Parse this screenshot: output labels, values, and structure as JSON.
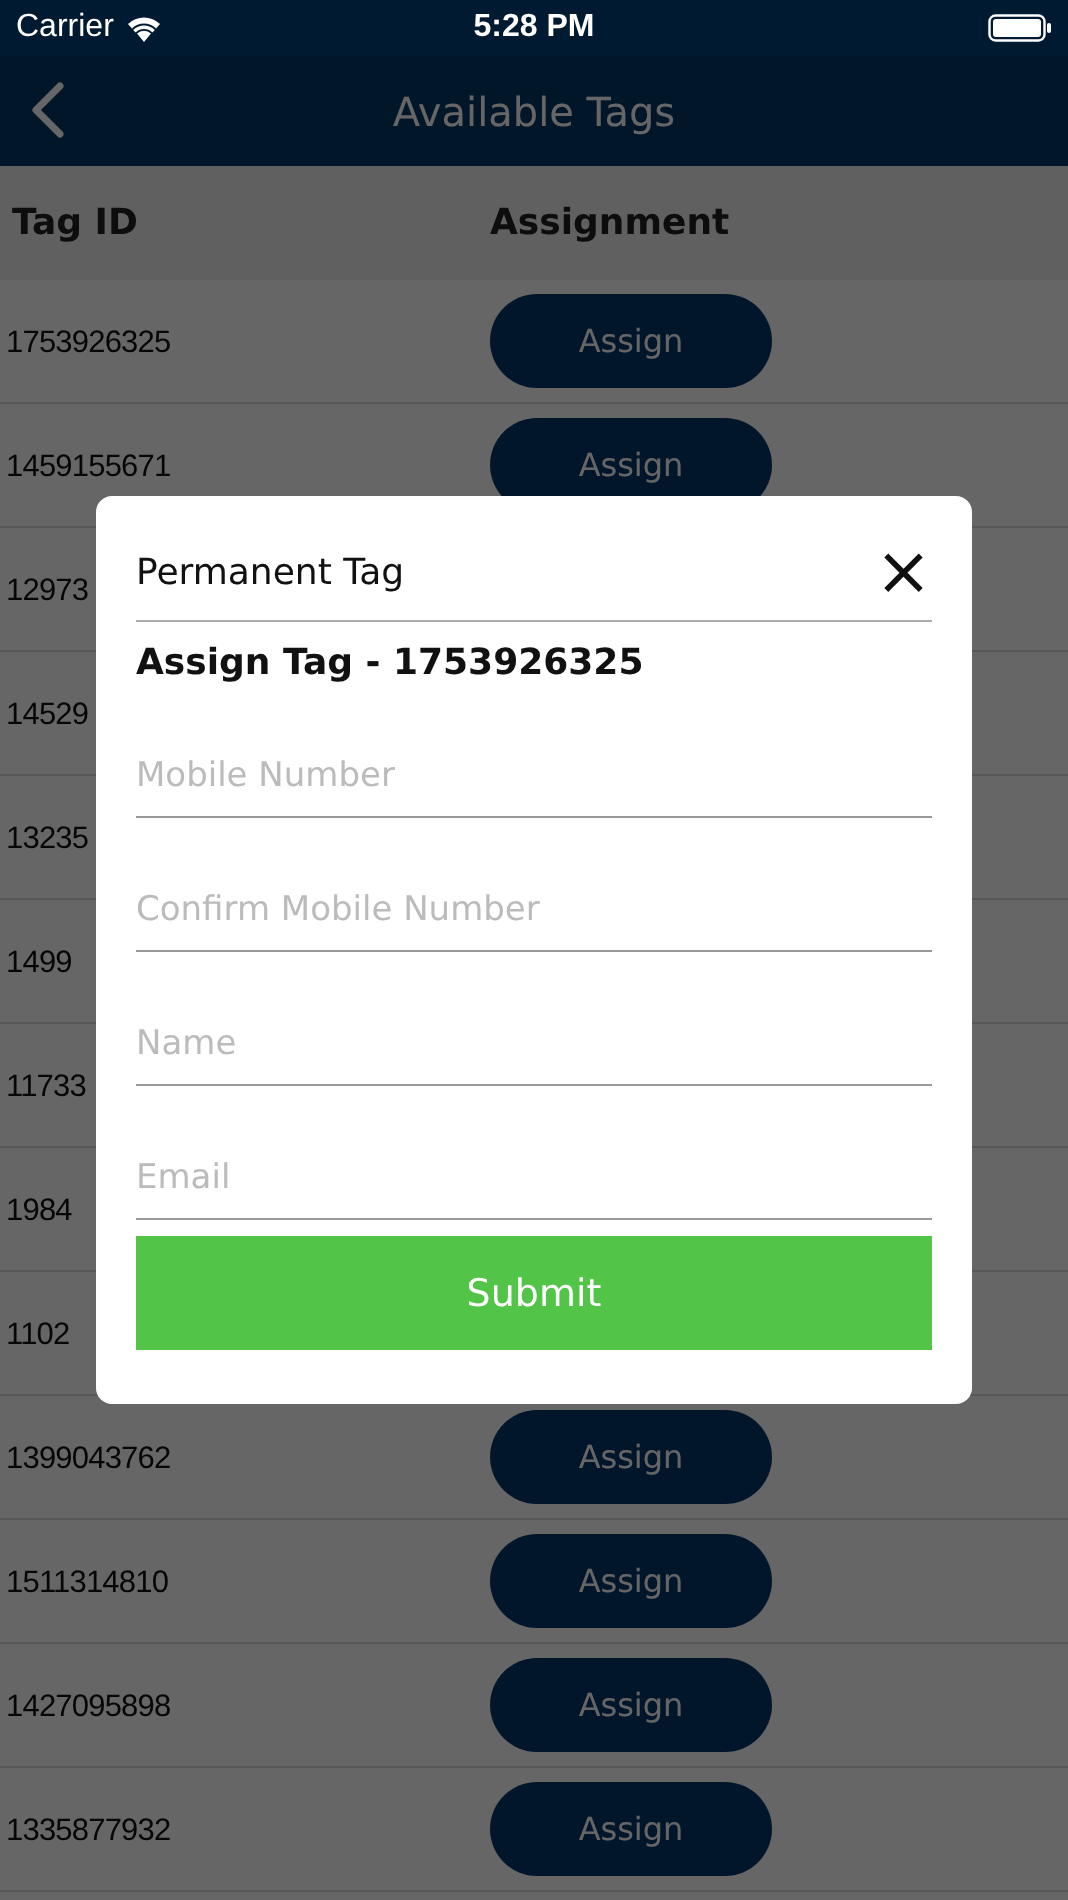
{
  "status_bar": {
    "carrier": "Carrier",
    "time": "5:28 PM"
  },
  "nav": {
    "title": "Available Tags"
  },
  "table": {
    "columns": [
      "Tag ID",
      "Assignment"
    ],
    "rows": [
      {
        "tag_id": "1753926325",
        "action": "Assign"
      },
      {
        "tag_id": "1459155671",
        "action": "Assign"
      },
      {
        "tag_id": "12973"
      },
      {
        "tag_id": "14529"
      },
      {
        "tag_id": "13235"
      },
      {
        "tag_id": "1499"
      },
      {
        "tag_id": "11733"
      },
      {
        "tag_id": "1984"
      },
      {
        "tag_id": "1102"
      },
      {
        "tag_id": "1399043762",
        "action": "Assign"
      },
      {
        "tag_id": "1511314810",
        "action": "Assign"
      },
      {
        "tag_id": "1427095898",
        "action": "Assign"
      },
      {
        "tag_id": "1335877932",
        "action": "Assign"
      }
    ]
  },
  "dialog": {
    "title": "Permanent Tag",
    "close": "×",
    "subtitle": "Assign Tag - 1753926325",
    "fields": [
      {
        "placeholder": "Mobile Number"
      },
      {
        "placeholder": "Confirm Mobile Number"
      },
      {
        "placeholder": "Name"
      },
      {
        "placeholder": "Email"
      }
    ],
    "submit": "Submit"
  }
}
